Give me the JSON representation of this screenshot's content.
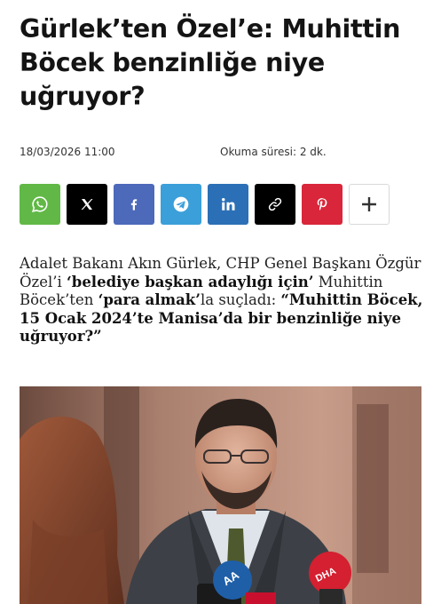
{
  "article": {
    "title": "Gürlek’ten Özel’e: Muhittin Böcek benzinliğe niye uğruyor?",
    "date": "18/03/2026 11:00",
    "reading_time": "Okuma süresi: 2 dk.",
    "lead": {
      "part1": "Adalet Bakanı Akın Gürlek, CHP Genel Başkanı Özgür Özel’i ",
      "bold1": "‘belediye başkan adaylığı için’",
      "part2": " Muhittin Böcek’ten ",
      "bold2": "‘para almak’",
      "part3": "la suçladı: ",
      "quote": "“Muhittin Böcek, 15 Ocak 2024’te Manisa’da bir benzinliğe niye uğruyor?”"
    },
    "photo_mic_labels": [
      "AA",
      "DHA"
    ]
  },
  "share": [
    {
      "name": "whatsapp",
      "icon": "whatsapp-icon",
      "color": "#61b846"
    },
    {
      "name": "x",
      "icon": "x-icon",
      "color": "#000000"
    },
    {
      "name": "facebook",
      "icon": "facebook-icon",
      "color": "#4c69ba"
    },
    {
      "name": "telegram",
      "icon": "telegram-icon",
      "color": "#3b9fd9"
    },
    {
      "name": "linkedin",
      "icon": "linkedin-icon",
      "color": "#2b70b6"
    },
    {
      "name": "copy-link",
      "icon": "link-icon",
      "color": "#000000"
    },
    {
      "name": "pinterest",
      "icon": "pinterest-icon",
      "color": "#d9263a"
    },
    {
      "name": "more",
      "icon": "plus-icon",
      "color": "#ffffff"
    }
  ]
}
